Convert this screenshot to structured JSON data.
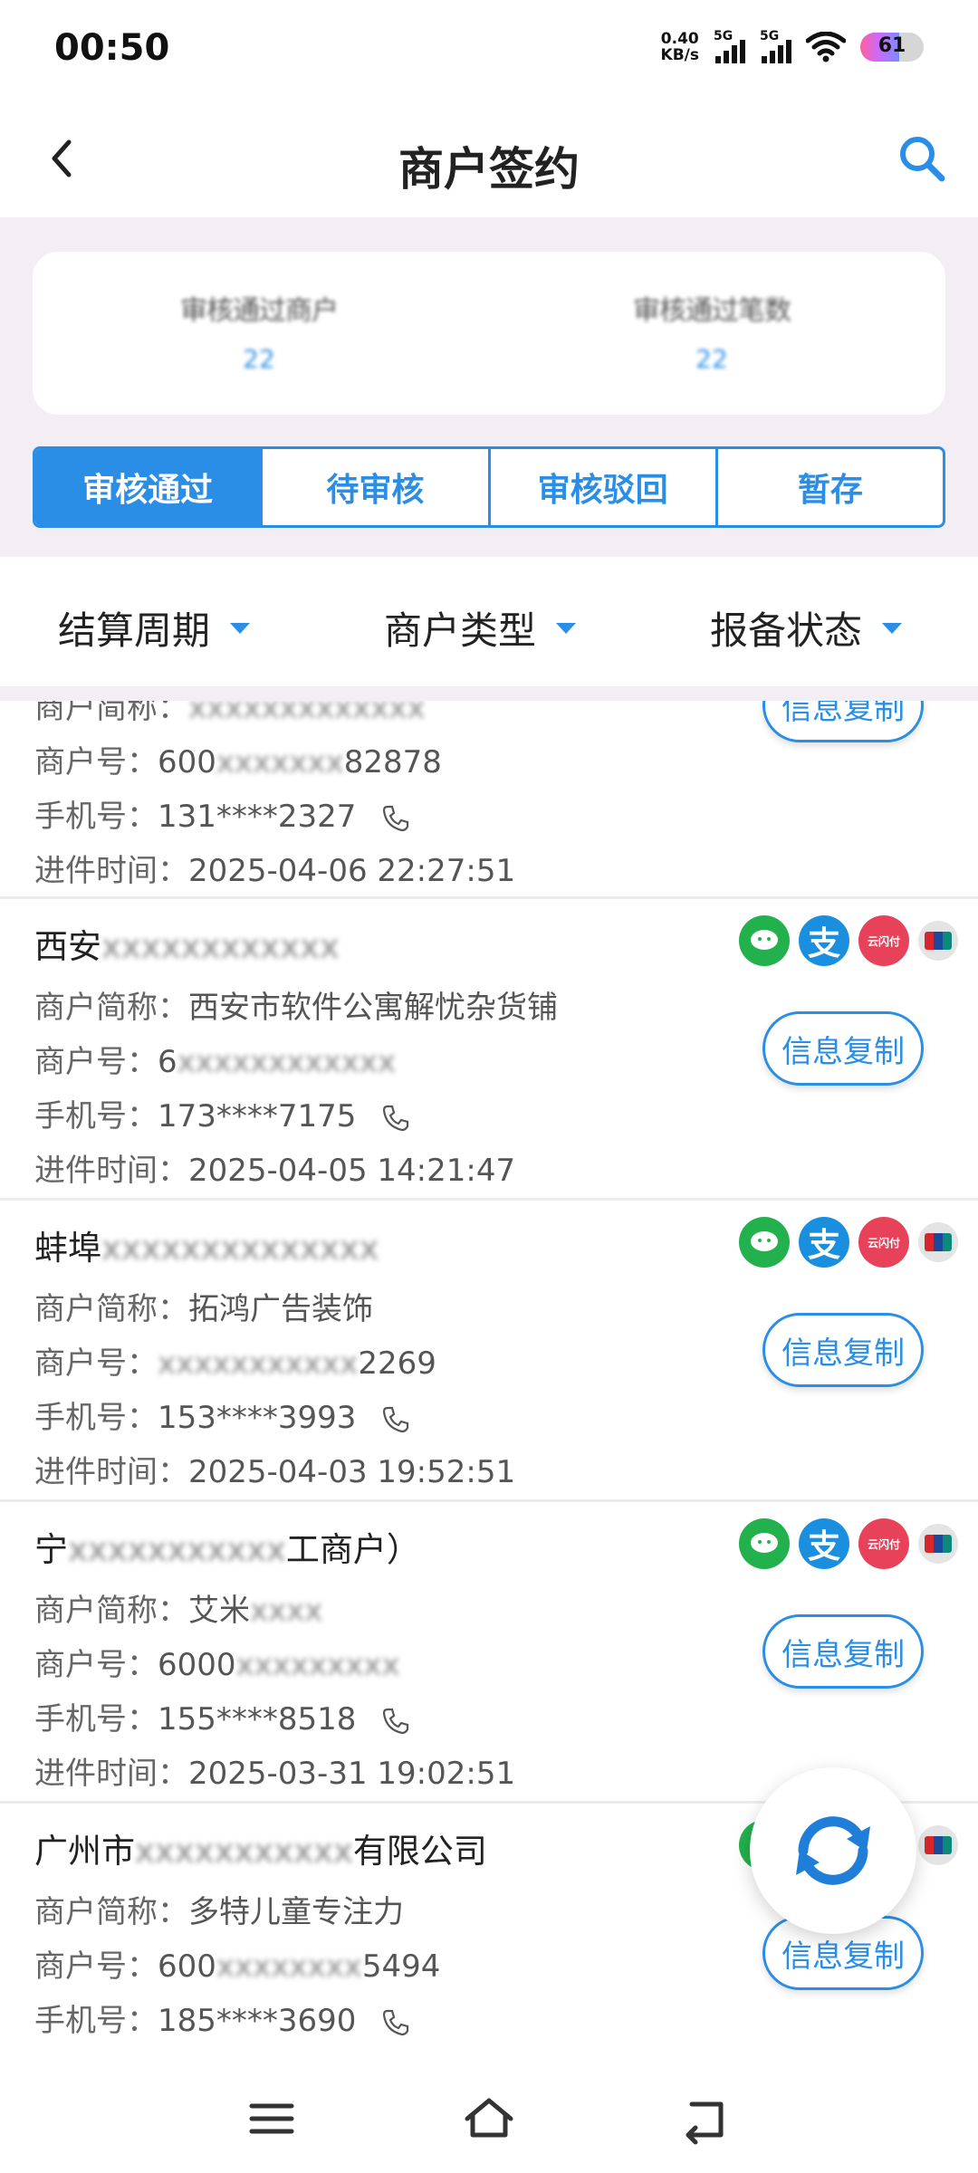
{
  "status_bar": {
    "time": "00:50",
    "net_speed_value": "0.40",
    "net_speed_unit": "KB/s",
    "signal1_label": "5G",
    "signal2_label": "5G",
    "battery": "61"
  },
  "header": {
    "title": "商户签约"
  },
  "summary": {
    "col1_label": "审核通过商户",
    "col1_value": "22",
    "col2_label": "审核通过笔数",
    "col2_value": "22"
  },
  "tabs": [
    {
      "label": "审核通过",
      "active": true
    },
    {
      "label": "待审核",
      "active": false
    },
    {
      "label": "审核驳回",
      "active": false
    },
    {
      "label": "暂存",
      "active": false
    }
  ],
  "filters": [
    {
      "label": "结算周期"
    },
    {
      "label": "商户类型"
    },
    {
      "label": "报备状态"
    }
  ],
  "labels": {
    "short_name": "商户简称：",
    "merchant_no": "商户号：",
    "phone": "手机号：",
    "time": "进件时间：",
    "copy": "信息复制"
  },
  "merchants": [
    {
      "name": "",
      "short_name_visible": "",
      "short_name_blurred": "xxxxxxxxxxxxx",
      "merchant_no_prefix": "600",
      "merchant_no_blurred": "xxxxxxx",
      "merchant_no_suffix": "82878",
      "phone": "131****2327",
      "time": "2025-04-06 22:27:51"
    },
    {
      "name_visible": "西安",
      "name_blurred": "xxxxxxxxxxxx",
      "short_name_visible": "西安市软件公寓解忧杂货铺",
      "merchant_no_prefix": "6",
      "merchant_no_blurred": "xxxxxxxxxxxx",
      "merchant_no_suffix": "",
      "phone": "173****7175",
      "time": "2025-04-05 14:21:47"
    },
    {
      "name_visible": "蚌埠",
      "name_blurred": "xxxxxxxxxxxxxx",
      "short_name_visible": "拓鸿广告装饰",
      "merchant_no_prefix": "",
      "merchant_no_blurred": "xxxxxxxxxxx",
      "merchant_no_suffix": "2269",
      "phone": "153****3993",
      "time": "2025-04-03 19:52:51"
    },
    {
      "name_visible": "宁",
      "name_blurred": "xxxxxxxxxxx",
      "name_suffix": "工商户）",
      "short_name_visible": "艾米",
      "short_name_blurred": "xxxx",
      "merchant_no_prefix": "6000",
      "merchant_no_blurred": "xxxxxxxxx",
      "merchant_no_suffix": "",
      "phone": "155****8518",
      "time": "2025-03-31 19:02:51"
    },
    {
      "name_visible": "广州市",
      "name_blurred": "xxxxxxxxxxx",
      "name_suffix": "有限公司",
      "short_name_visible": "多特儿童专注力",
      "merchant_no_prefix": "600",
      "merchant_no_blurred": "xxxxxxxx",
      "merchant_no_suffix": "5494",
      "phone": "185****3690",
      "time": ""
    }
  ],
  "pay_icons": {
    "yun_label": "云闪付"
  },
  "colors": {
    "accent": "#2b8ee6",
    "background_tint": "#f3eef4",
    "wechat": "#22b14c",
    "alipay": "#1a8fe0",
    "unionpay": "#e8415a"
  },
  "icons": [
    "back-icon",
    "search-icon",
    "caret-down-icon",
    "phone-icon",
    "wechat-pay-icon",
    "alipay-icon",
    "yunshanfu-icon",
    "unionpay-icon",
    "refresh-icon",
    "menu-icon",
    "home-icon",
    "back-nav-icon"
  ]
}
